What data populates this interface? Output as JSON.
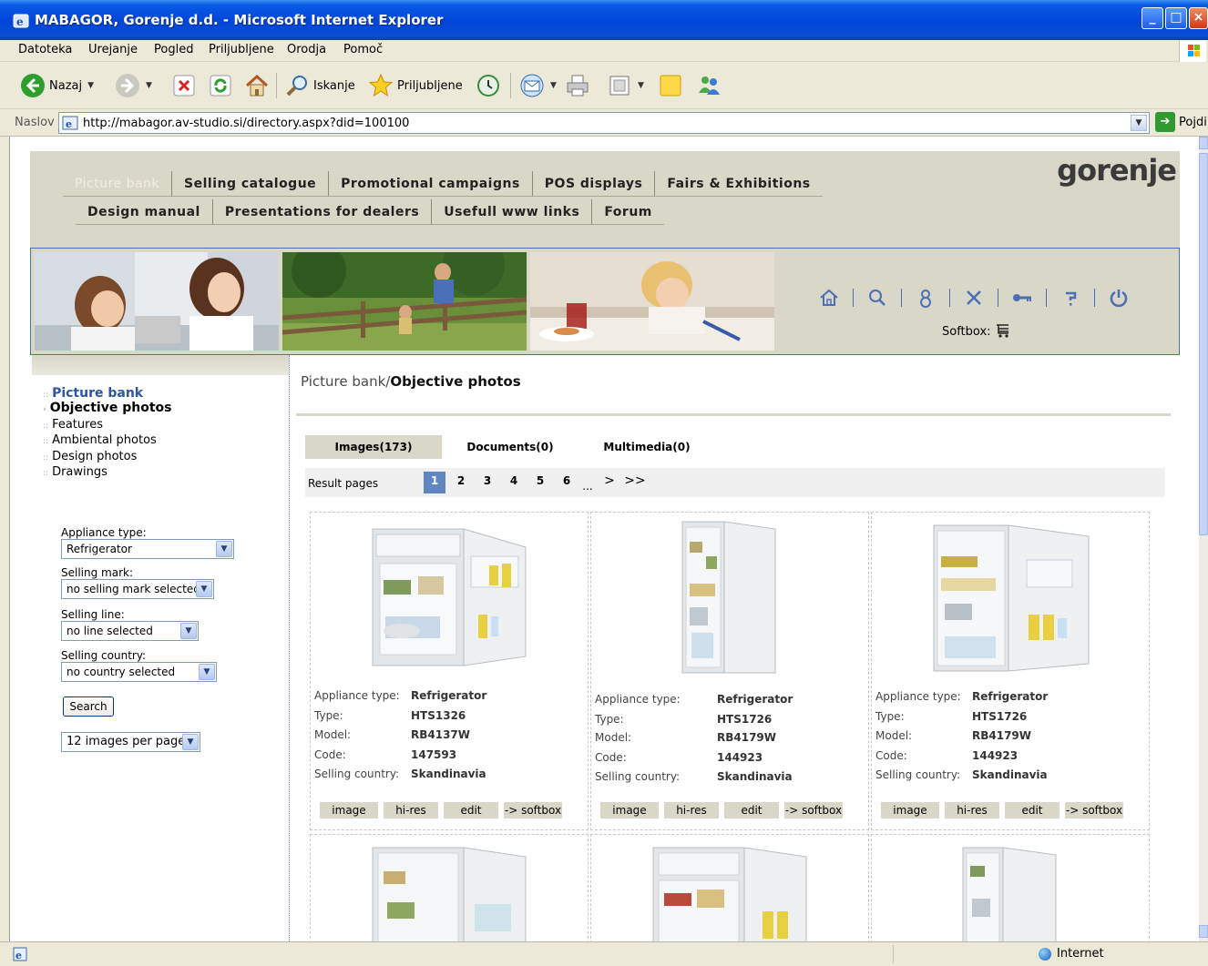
{
  "window": {
    "title": "MABAGOR, Gorenje d.d. - Microsoft Internet Explorer"
  },
  "menu": [
    "Datoteka",
    "Urejanje",
    "Pogled",
    "Priljubljene",
    "Orodja",
    "Pomoč"
  ],
  "toolbar": {
    "back": "Nazaj",
    "search": "Iskanje",
    "favorites": "Priljubljene"
  },
  "address": {
    "label": "Naslov",
    "url": "http://mabagor.av-studio.si/directory.aspx?did=100100",
    "go": "Pojdi"
  },
  "status": {
    "zone": "Internet"
  },
  "site": {
    "logo": "gorenje",
    "nav_row1": [
      "Picture bank",
      "Selling catalogue",
      "Promotional campaigns",
      "POS displays",
      "Fairs & Exhibitions"
    ],
    "nav_row2": [
      "Design manual",
      "Presentations for dealers",
      "Usefull www links",
      "Forum"
    ],
    "softbox": "Softbox:"
  },
  "tree": {
    "root": "Picture bank",
    "items": [
      "Objective photos",
      "Features",
      "Ambiental photos",
      "Design photos",
      "Drawings"
    ]
  },
  "filters": {
    "appliance_label": "Appliance type:",
    "appliance_value": "Refrigerator",
    "mark_label": "Selling mark:",
    "mark_value": "no selling mark selected",
    "line_label": "Selling line:",
    "line_value": "no line selected",
    "country_label": "Selling country:",
    "country_value": "no country selected",
    "search": "Search",
    "per_page": "12 images per page"
  },
  "breadcrumb": {
    "path": "Picture bank/",
    "current": "Objective photos"
  },
  "tabs": [
    "Images(173)",
    "Documents(0)",
    "Multimedia(0)"
  ],
  "pager": {
    "label": "Result pages",
    "pages": [
      "1",
      "2",
      "3",
      "4",
      "5",
      "6"
    ],
    "ellipsis": "...",
    "next": ">",
    "last": ">>"
  },
  "attr_labels": [
    "Appliance type:",
    "Type:",
    "Model:",
    "Code:",
    "Selling country:"
  ],
  "cards": [
    {
      "values": [
        "Refrigerator",
        "HTS1326",
        "RB4137W",
        "147593",
        "Skandinavia"
      ]
    },
    {
      "values": [
        "Refrigerator",
        "HTS1726",
        "RB4179W",
        "144923",
        "Skandinavia"
      ]
    },
    {
      "values": [
        "Refrigerator",
        "HTS1726",
        "RB4179W",
        "144923",
        "Skandinavia"
      ]
    }
  ],
  "card_buttons": [
    "image",
    "hi-res",
    "edit",
    "-> softbox"
  ]
}
